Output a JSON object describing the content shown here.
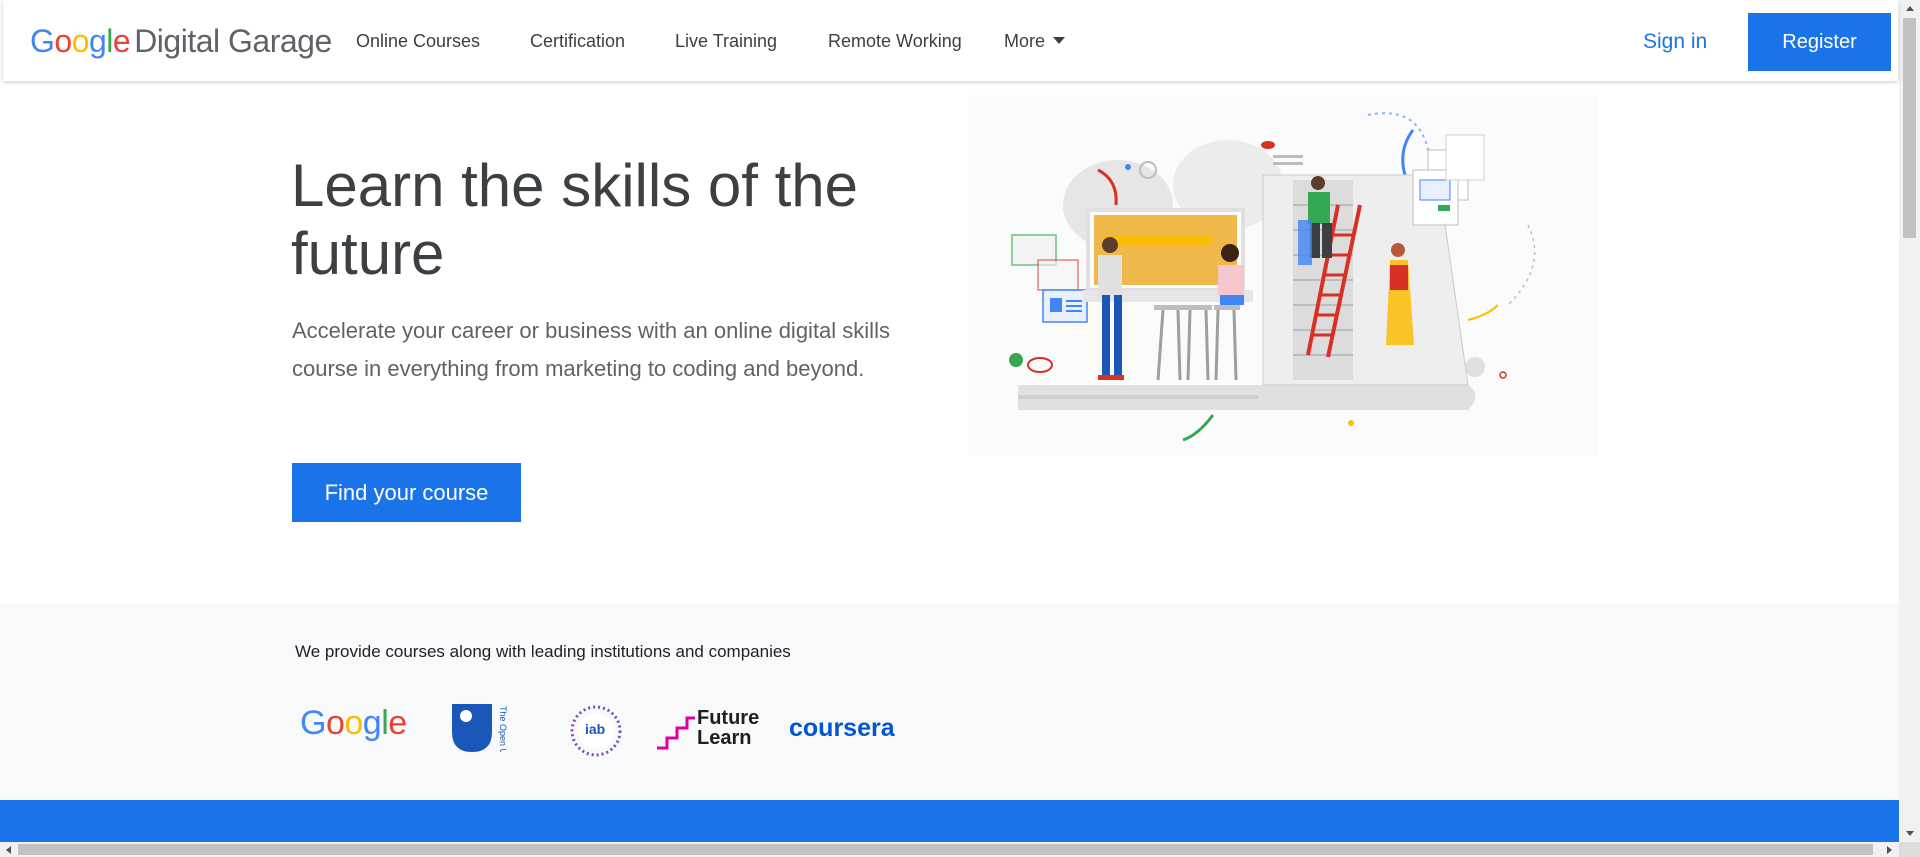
{
  "header": {
    "logo": {
      "google": [
        "G",
        "o",
        "o",
        "g",
        "l",
        "e"
      ],
      "product": "Digital Garage"
    },
    "nav": [
      {
        "label": "Online Courses"
      },
      {
        "label": "Certification"
      },
      {
        "label": "Live Training"
      },
      {
        "label": "Remote Working"
      },
      {
        "label": "More"
      }
    ],
    "sign_in": "Sign in",
    "register": "Register"
  },
  "hero": {
    "title": "Learn the skills of the future",
    "subtitle": "Accelerate your career or business with an online digital skills course in everything from marketing to coding and beyond.",
    "cta": "Find your course",
    "illustration_icon": "people-learning-illustration"
  },
  "partners": {
    "heading": "We provide courses along with leading institutions and companies",
    "logos": [
      {
        "name": "Google",
        "text": "Google"
      },
      {
        "name": "The Open University",
        "text": "The Open University"
      },
      {
        "name": "iab",
        "text": "iab"
      },
      {
        "name": "FutureLearn",
        "line1": "Future",
        "line2": "Learn"
      },
      {
        "name": "Coursera",
        "text": "coursera"
      }
    ]
  },
  "colors": {
    "brand_blue": "#1a73e8",
    "google_blue": "#4285f4",
    "google_red": "#ea4335",
    "google_yellow": "#fbbc05",
    "google_green": "#34a853",
    "text_dark": "#3c4043",
    "partners_bg": "#f8f9fa"
  }
}
